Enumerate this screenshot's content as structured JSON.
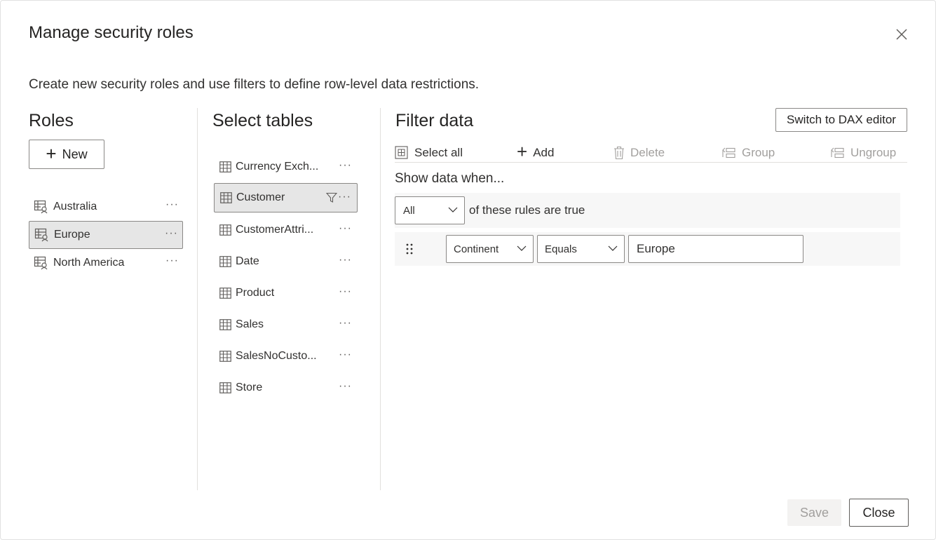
{
  "dialog": {
    "title": "Manage security roles",
    "description": "Create new security roles and use filters to define row-level data restrictions."
  },
  "roles": {
    "heading": "Roles",
    "new_label": "New",
    "items": [
      {
        "label": "Australia",
        "selected": false
      },
      {
        "label": "Europe",
        "selected": true
      },
      {
        "label": "North America",
        "selected": false
      }
    ],
    "more_label": "···"
  },
  "tables": {
    "heading": "Select tables",
    "more_label": "···",
    "items": [
      {
        "label": "Currency Exch...",
        "selected": false,
        "filtered": false
      },
      {
        "label": "Customer",
        "selected": true,
        "filtered": true
      },
      {
        "label": "CustomerAttri...",
        "selected": false,
        "filtered": false
      },
      {
        "label": "Date",
        "selected": false,
        "filtered": false
      },
      {
        "label": "Product",
        "selected": false,
        "filtered": false
      },
      {
        "label": "Sales",
        "selected": false,
        "filtered": false
      },
      {
        "label": "SalesNoCusto...",
        "selected": false,
        "filtered": false
      },
      {
        "label": "Store",
        "selected": false,
        "filtered": false
      }
    ]
  },
  "filter": {
    "heading": "Filter data",
    "dax_button": "Switch to DAX editor",
    "toolbar": {
      "select_all": "Select all",
      "add": "Add",
      "delete": "Delete",
      "group": "Group",
      "ungroup": "Ungroup"
    },
    "show_when": "Show data when...",
    "match_select": "All",
    "match_text": "of these rules are true",
    "rule": {
      "column": "Continent",
      "operator": "Equals",
      "value": "Europe"
    }
  },
  "footer": {
    "save": "Save",
    "close": "Close"
  },
  "colors": {
    "selected_bg": "#e6e6e6",
    "border": "#8a8886",
    "disabled_text": "#a19f9d"
  }
}
